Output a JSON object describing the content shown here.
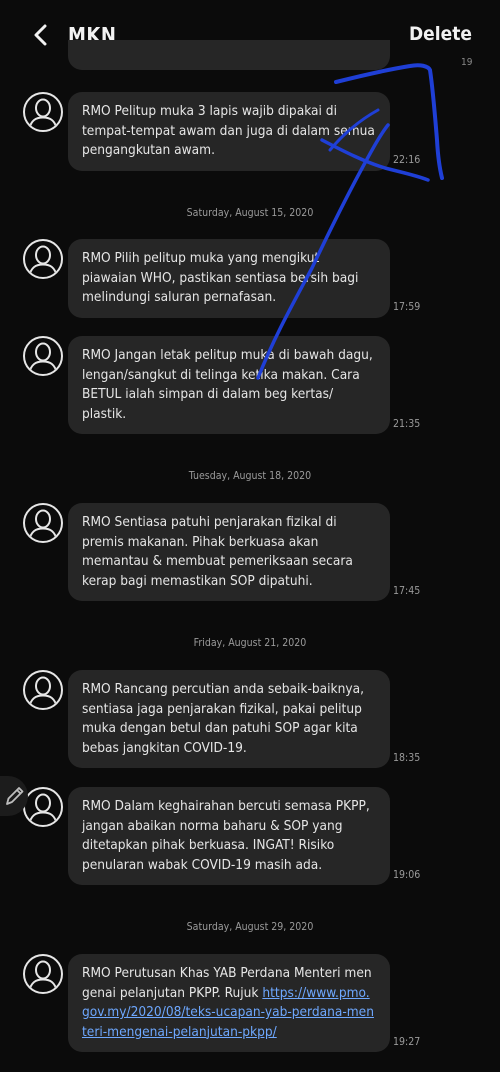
{
  "header": {
    "title": "MKN",
    "delete_label": "Delete"
  },
  "colors": {
    "background": "#0b0b0b",
    "bubble": "#262626",
    "link": "#6ea8ff",
    "annotation": "#1f3fd6"
  },
  "top_time": "19",
  "messages": [
    {
      "text": "RMO Pelitup muka 3 lapis wajib dipakai di tempat-tempat awam dan juga di dalam semua pengangkutan awam.",
      "time": "22:16"
    },
    {
      "text": "RMO Pilih pelitup muka yang mengikut piawaian WHO, pastikan sentiasa bersih bagi melindungi saluran pernafasan.",
      "time": "17:59"
    },
    {
      "text": "RMO Jangan letak pelitup muka di bawah dagu, lengan/sangkut di telinga ketika makan. Cara BETUL ialah simpan di dalam beg kertas/ plastik.",
      "time": "21:35"
    },
    {
      "text": "RMO Sentiasa patuhi penjarakan fizikal di premis makanan. Pihak berkuasa akan memantau & membuat pemeriksaan secara kerap bagi memastikan SOP dipatuhi.",
      "time": "17:45"
    },
    {
      "text": "RMO Rancang percutian anda sebaik-baiknya, sentiasa jaga penjarakan fizikal, pakai pelitup muka dengan betul dan patuhi SOP agar kita bebas jangkitan COVID-19.",
      "time": "18:35"
    },
    {
      "text": "RMO Dalam keghairahan bercuti semasa PKPP, jangan abaikan norma baharu & SOP yang ditetapkan pihak berkuasa. INGAT! Risiko penularan wabak COVID-19 masih ada.",
      "time": "19:06"
    },
    {
      "text": "RMO Perutusan Khas YAB Perdana Menteri mengenai pelanjutan PKPP. Rujuk ",
      "link": "https://www.pmo.gov.my/2020/08/teks-ucapan-yab-perdana-menteri-mengenai-pelanjutan-pkpp/",
      "time": "19:27"
    }
  ],
  "dates": [
    "Saturday, August 15, 2020",
    "Tuesday, August 18, 2020",
    "Friday, August 21, 2020",
    "Saturday, August 29, 2020"
  ],
  "icons": {
    "back": "chevron-left-icon",
    "avatar": "person-icon",
    "compose": "pencil-icon"
  }
}
